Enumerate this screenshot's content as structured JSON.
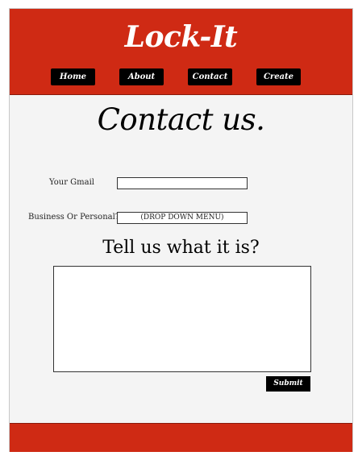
{
  "header": {
    "brand": "Lock-It",
    "nav": [
      {
        "label": "Home"
      },
      {
        "label": "About"
      },
      {
        "label": "Contact"
      },
      {
        "label": "Create"
      }
    ]
  },
  "main": {
    "title": "Contact us.",
    "form": {
      "email_label": "Your Gmail",
      "email_value": "",
      "type_label": "Business Or Personal?",
      "type_value": "(DROP DOWN MENU)",
      "message_title": "Tell us what it is?",
      "message_value": "",
      "submit_label": "Submit"
    }
  },
  "colors": {
    "brand_red": "#cf2a14",
    "page_bg": "#f4f4f4",
    "button_bg": "#000000"
  }
}
